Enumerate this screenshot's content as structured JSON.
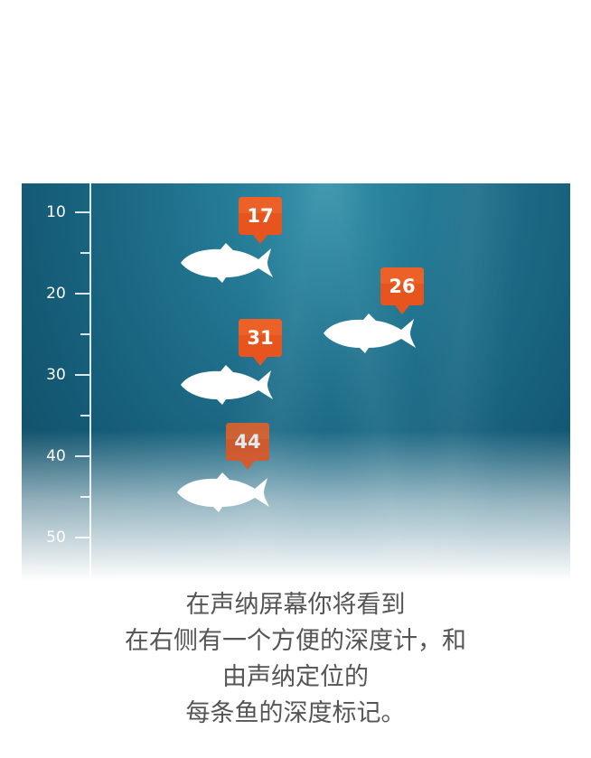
{
  "depth_scale": {
    "labels": [
      "10",
      "20",
      "30",
      "40",
      "50"
    ]
  },
  "fish_markers": [
    {
      "depth": "17"
    },
    {
      "depth": "26"
    },
    {
      "depth": "31"
    },
    {
      "depth": "44"
    }
  ],
  "caption": {
    "lines": [
      "在声纳屏幕你将看到",
      "在右侧有一个方便的深度计，和",
      "由声纳定位的",
      "每条鱼的深度标记。"
    ]
  },
  "colors": {
    "badge": "#e8541e",
    "water": "#1f6f8b",
    "caption_text": "#555555"
  },
  "icons": {
    "fish": "fish-icon",
    "badge": "depth-marker-badge"
  }
}
